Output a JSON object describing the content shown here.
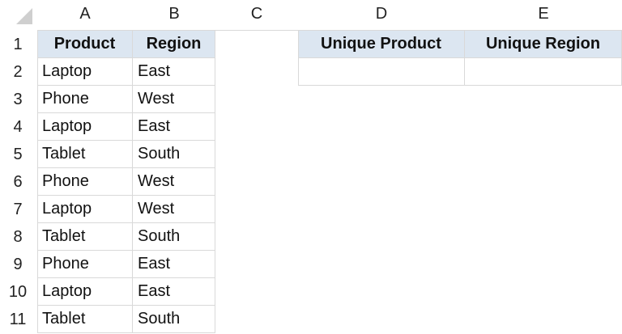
{
  "columns": [
    "A",
    "B",
    "C",
    "D",
    "E"
  ],
  "rows": [
    "1",
    "2",
    "3",
    "4",
    "5",
    "6",
    "7",
    "8",
    "9",
    "10",
    "11"
  ],
  "headers": {
    "product": "Product",
    "region": "Region",
    "unique_product": "Unique Product",
    "unique_region": "Unique Region"
  },
  "data": [
    {
      "product": "Laptop",
      "region": "East"
    },
    {
      "product": "Phone",
      "region": "West"
    },
    {
      "product": "Laptop",
      "region": "East"
    },
    {
      "product": "Tablet",
      "region": "South"
    },
    {
      "product": "Phone",
      "region": "West"
    },
    {
      "product": "Laptop",
      "region": "West"
    },
    {
      "product": "Tablet",
      "region": "South"
    },
    {
      "product": "Phone",
      "region": "East"
    },
    {
      "product": "Laptop",
      "region": "East"
    },
    {
      "product": "Tablet",
      "region": "South"
    }
  ],
  "unique_values": {
    "product": "",
    "region": ""
  },
  "colors": {
    "header_fill": "#dce6f1",
    "gridline": "#d9d9d9"
  }
}
